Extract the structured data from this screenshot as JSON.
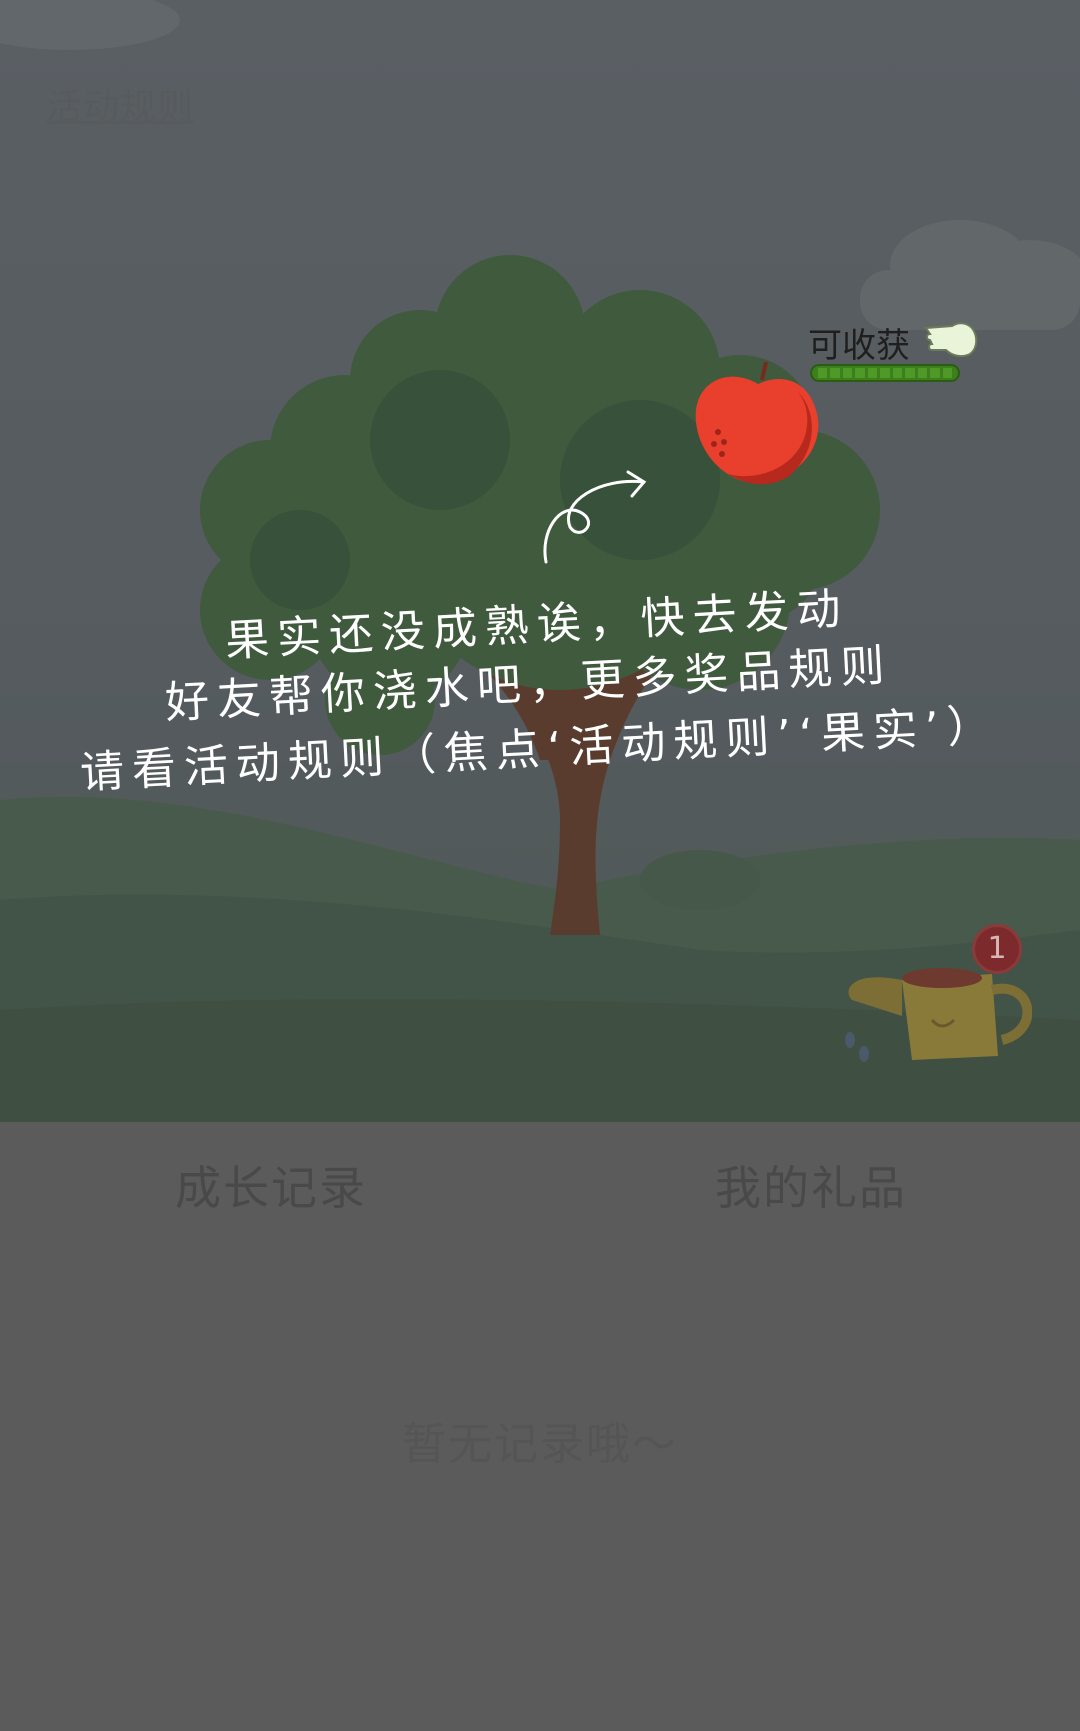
{
  "header": {
    "rules_link": "活动规则"
  },
  "fruit": {
    "harvest_label": "可收获",
    "progress_fraction": 1.0
  },
  "hint": {
    "line1": "果实还没成熟诶，快去发动",
    "line2": "好友帮你浇水吧，更多奖品规则",
    "line3": "请看活动规则（焦点‘活动规则’‘果实’）"
  },
  "watering": {
    "badge_count": "1"
  },
  "tabs": [
    {
      "label": "成长记录"
    },
    {
      "label": "我的礼品"
    }
  ],
  "records": {
    "empty_text": "暂无记录哦～"
  },
  "colors": {
    "overlay": "#595a5c",
    "apple": "#e8402c",
    "progress": "#3d7e1e"
  }
}
